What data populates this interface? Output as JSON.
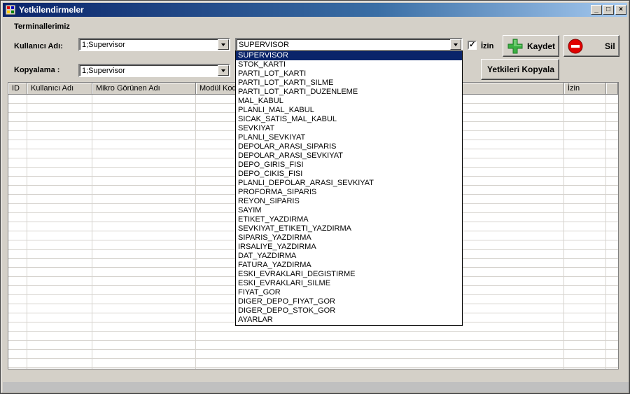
{
  "window": {
    "title": "Yetkilendirmeler",
    "minimize": "_",
    "maximize": "□",
    "close": "×"
  },
  "form": {
    "section_title": "Terminallerimiz",
    "user_label": "Kullanıcı Adı:",
    "user_value": "1;Supervisor",
    "module_value": "SUPERVISOR",
    "permission_label": "İzin",
    "permission_checked": "✓",
    "copy_label": "Kopyalama :",
    "copy_value": "1;Supervisor",
    "save_label": "Kaydet",
    "delete_label": "Sil",
    "copy_button_label": "Yetkileri Kopyala"
  },
  "grid": {
    "columns": [
      "ID",
      "Kullanıcı Adı",
      "Mikro Görünen Adı",
      "Modül Kodu",
      "",
      "İzin"
    ]
  },
  "dropdown": {
    "items": [
      "SUPERVISOR",
      "STOK_KARTI",
      "PARTI_LOT_KARTI",
      "PARTI_LOT_KARTI_SILME",
      "PARTI_LOT_KARTI_DUZENLEME",
      "MAL_KABUL",
      "PLANLI_MAL_KABUL",
      "SICAK_SATIS_MAL_KABUL",
      "SEVKIYAT",
      "PLANLI_SEVKIYAT",
      "DEPOLAR_ARASI_SIPARIS",
      "DEPOLAR_ARASI_SEVKIYAT",
      "DEPO_GIRIS_FISI",
      "DEPO_CIKIS_FISI",
      "PLANLI_DEPOLAR_ARASI_SEVKIYAT",
      "PROFORMA_SIPARIS",
      "REYON_SIPARIS",
      "SAYIM",
      "ETIKET_YAZDIRMA",
      "SEVKIYAT_ETIKETI_YAZDIRMA",
      "SIPARIS_YAZDIRMA",
      "IRSALIYE_YAZDIRMA",
      "DAT_YAZDIRMA",
      "FATURA_YAZDIRMA",
      "ESKI_EVRAKLARI_DEGISTIRME",
      "ESKI_EVRAKLARI_SILME",
      "FIYAT_GOR",
      "DIGER_DEPO_FIYAT_GOR",
      "DIGER_DEPO_STOK_GOR",
      "AYARLAR"
    ],
    "selected_index": 0
  },
  "colors": {
    "titlebar": "#0a246a",
    "selection": "#0a246a",
    "add_icon": "#3cb043",
    "delete_icon": "#e00000"
  }
}
